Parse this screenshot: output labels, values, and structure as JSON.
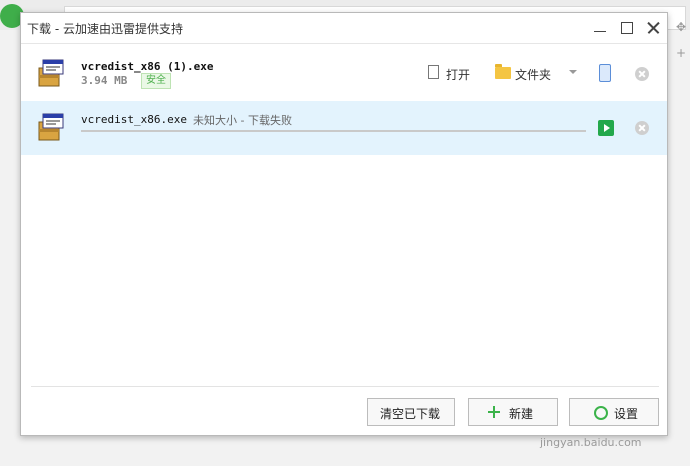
{
  "window": {
    "title": "下载 - 云加速由迅雷提供支持"
  },
  "downloads": [
    {
      "filename": "vcredist_x86 (1).exe",
      "size": "3.94 MB",
      "badge": "安全",
      "actions": {
        "open": "打开",
        "folder": "文件夹"
      }
    },
    {
      "filename": "vcredist_x86.exe",
      "status": "未知大小 - 下载失败"
    }
  ],
  "footer": {
    "clear_label": "清空已下载",
    "new_label": "新建",
    "settings_label": "设置"
  },
  "watermark": "jingyan.baidu.com",
  "colors": {
    "accent_green": "#23a84b",
    "selected_row": "#e3f3fd",
    "safe_badge": "#4cae4c"
  }
}
